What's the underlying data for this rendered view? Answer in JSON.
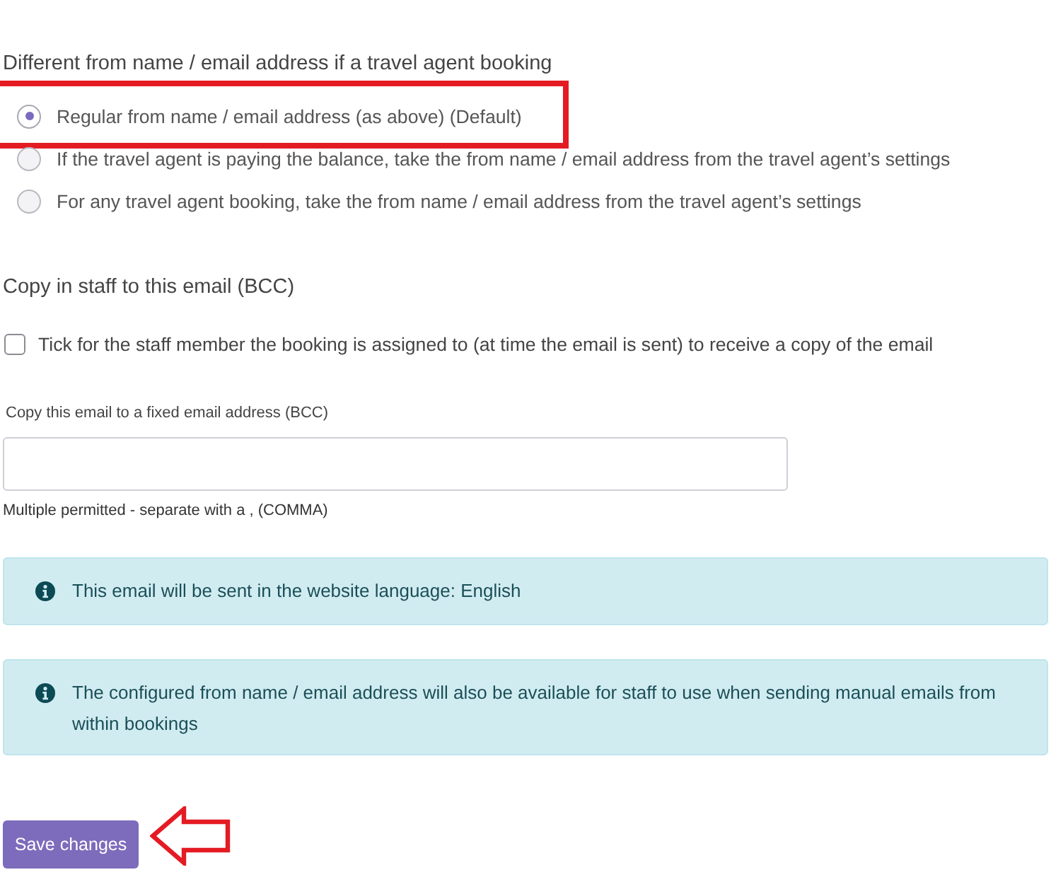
{
  "from_section": {
    "heading": "Different from name / email address if a travel agent booking",
    "options": [
      {
        "label": "Regular from name / email address (as above) (Default)",
        "selected": true,
        "highlighted": true
      },
      {
        "label": "If the travel agent is paying the balance, take the from name / email address from the travel agent’s settings",
        "selected": false,
        "highlighted": false
      },
      {
        "label": "For any travel agent booking, take the from name / email address from the travel agent’s settings",
        "selected": false,
        "highlighted": false
      }
    ]
  },
  "bcc_section": {
    "heading": "Copy in staff to this email (BCC)",
    "checkbox": {
      "label": "Tick for the staff member the booking is assigned to (at time the email is sent) to receive a copy of the email",
      "checked": false
    },
    "field": {
      "label": "Copy this email to a fixed email address (BCC)",
      "help": "Multiple permitted - separate with a , (COMMA)"
    }
  },
  "alerts": [
    {
      "text": "This email will be sent in the website language: English"
    },
    {
      "text": "The configured from name / email address will also be available for staff to use when sending manual emails from within bookings"
    }
  ],
  "save_button": {
    "label": "Save changes",
    "pointed_at": true
  }
}
